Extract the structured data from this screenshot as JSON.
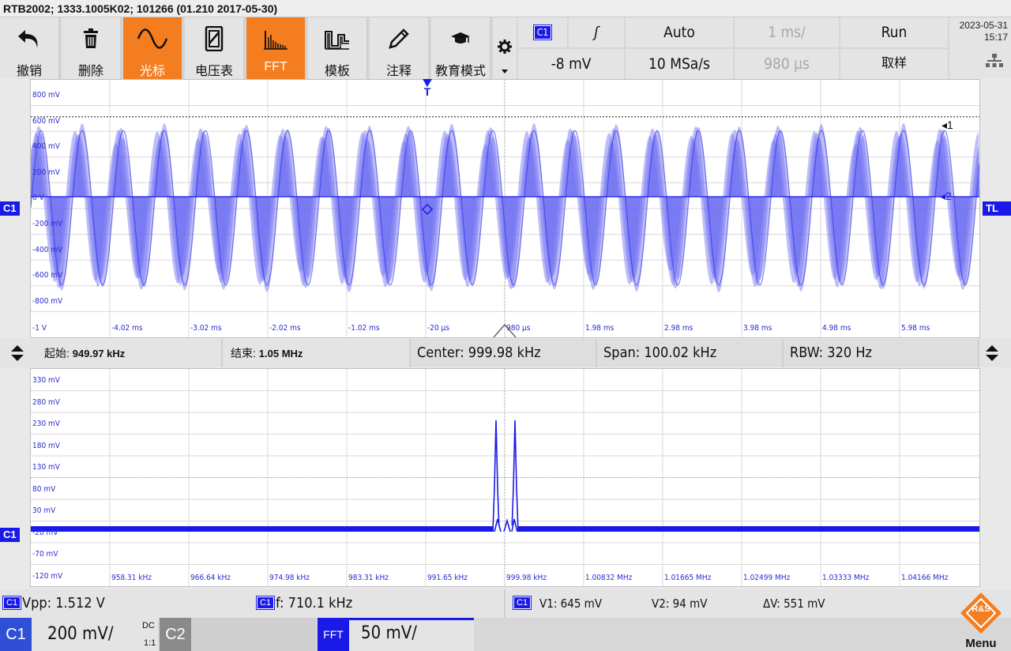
{
  "title": "RTB2002; 1333.1005K02; 101266 (01.210 2017-05-30)",
  "toolbar": {
    "buttons": [
      {
        "label": "撤销",
        "icon": "undo-icon",
        "active": false
      },
      {
        "label": "删除",
        "icon": "trash-icon",
        "active": false
      },
      {
        "label": "光标",
        "icon": "cursor-wave-icon",
        "active": true
      },
      {
        "label": "电压表",
        "icon": "voltmeter-icon",
        "active": false
      },
      {
        "label": "FFT",
        "icon": "fft-icon",
        "active": true
      },
      {
        "label": "模板",
        "icon": "mask-icon",
        "active": false
      },
      {
        "label": "注释",
        "icon": "pencil-icon",
        "active": false
      },
      {
        "label": "教育模式",
        "icon": "graduation-cap-icon",
        "active": false
      }
    ],
    "settings_icon": "gear-icon"
  },
  "trigger": {
    "source": "C1",
    "slope_symbol": "ʃ",
    "mode": "Auto",
    "level": "-8 mV",
    "sample_rate": "10 MSa/s"
  },
  "timebase": {
    "scale": "1 ms/",
    "position": "980 µs"
  },
  "acquisition": {
    "state": "Run",
    "mode": "取样"
  },
  "clock": {
    "date": "2023-05-31",
    "time": "15:17"
  },
  "time_domain": {
    "y_labels": [
      "800 mV",
      "600 mV",
      "400 mV",
      "200 mV",
      "0 V",
      "-200 mV",
      "-400 mV",
      "-600 mV",
      "-800 mV"
    ],
    "x_labels": [
      "-1 V",
      "-4.02 ms",
      "-3.02 ms",
      "-2.02 ms",
      "-1.02 ms",
      "-20 µs",
      "980 µs",
      "1.98 ms",
      "2.98 ms",
      "3.98 ms",
      "4.98 ms",
      "5.98 ms"
    ],
    "channel_marker": "C1",
    "trigger_marker": "T",
    "trigger_level_marker": "TL",
    "cursor1_label": "1",
    "cursor2_label": "2",
    "cursor1_level_mv": 645,
    "cursor2_level_mv": 94,
    "waveform_color": "#6c6cf2"
  },
  "fft": {
    "start_label": "起始:",
    "start_value": "949.97 kHz",
    "stop_label": "结束:",
    "stop_value": "1.05 MHz",
    "center": "Center: 999.98 kHz",
    "span": "Span: 100.02 kHz",
    "rbw": "RBW: 320 Hz",
    "y_labels": [
      "330 mV",
      "280 mV",
      "230 mV",
      "180 mV",
      "130 mV",
      "80 mV",
      "30 mV",
      "-20 mV",
      "-70 mV",
      "-120 mV"
    ],
    "x_labels": [
      "958.31 kHz",
      "966.64 kHz",
      "974.98 kHz",
      "983.31 kHz",
      "991.65 kHz",
      "999.98 kHz",
      "1.00832 MHz",
      "1.01665 MHz",
      "1.02499 MHz",
      "1.03333 MHz",
      "1.04166 MHz"
    ],
    "channel_marker": "C1",
    "spectrum_color": "#1a1ae8"
  },
  "measurements": {
    "vpp_ch": "C1",
    "vpp": "Vpp: 1.512 V",
    "freq_ch": "C1",
    "freq": "f: 710.1 kHz",
    "cursor_ch": "C1",
    "v1": "V1: 645 mV",
    "v2": "V2: 94 mV",
    "dv": "ΔV: 551 mV"
  },
  "channels": {
    "c1_label": "C1",
    "c1_scale": "200 mV/",
    "c1_coupling": "DC",
    "c1_ratio": "1:1",
    "c2_label": "C2",
    "fft_label": "FFT",
    "fft_scale": "50 mV/"
  },
  "logo": {
    "text": "R&S",
    "menu_label": "Menu"
  }
}
